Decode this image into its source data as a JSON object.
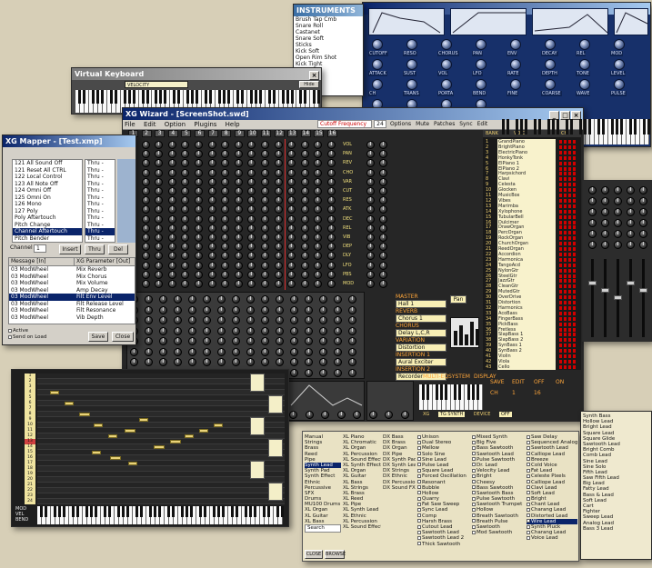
{
  "synth_editor": {
    "labels": [
      "CUTOFF",
      "RESO",
      "CHORUS",
      "PAN",
      "ENV",
      "DECAY",
      "REL",
      "MOD",
      "ATTACK",
      "SUST",
      "VOL",
      "LFO",
      "RATE",
      "DEPTH",
      "TONE",
      "LEVEL",
      "CH",
      "TRANS",
      "PORTA",
      "BEND",
      "FINE",
      "COARSE",
      "WAVE",
      "PULSE",
      "MIX",
      "GAIN",
      "VELO",
      "KEY",
      "DELAY",
      "FEED",
      "SPREAD",
      "OUT"
    ]
  },
  "instrument_list": {
    "title": "INSTRUMENTS",
    "items": [
      "Brush Tap Cmb",
      "Snare Roll",
      "Castanet",
      "Snare Soft",
      "Sticks",
      "Kick Soft",
      "Open Rim Shot",
      "Kick Tight",
      "Kick"
    ]
  },
  "virtual_keyboard": {
    "title": "Virtual Keyboard",
    "velocity_field": "VELOCITY",
    "close_btn": "Hide"
  },
  "main_window": {
    "title": "XG Wizard - [ScreenShot.swd]",
    "menu": [
      "File",
      "Edit",
      "Option",
      "Plugins",
      "Help"
    ],
    "toolbar_field": "Cutoff Frequency",
    "toolbar_field_value": "24",
    "toolbar_links": [
      "Options",
      "Mute",
      "Patches",
      "Sync",
      "Edit"
    ],
    "row_tags": [
      "VOL",
      "PAN",
      "REV",
      "CHO",
      "VAR",
      "CUT",
      "RES",
      "ATK",
      "DEC",
      "REL",
      "VIB",
      "DEP",
      "DLY",
      "LFO",
      "PBS",
      "MOD"
    ],
    "mode_labels": [
      "MASTER",
      "REVERB",
      "CHORUS",
      "VARIATION",
      "INSERTION 1",
      "INSERTION 2"
    ],
    "mode_values": [
      "Hall 1",
      "Chorus 1",
      "Delay L,C,R",
      "Distortion",
      "Aural Exciter",
      "Recorder"
    ],
    "side_labels": [
      "MULTI-EQ",
      "SYSTEM",
      "DISPLAY"
    ],
    "mode_note": "Pan",
    "voice_header": [
      "BANK",
      "VOICE",
      "CH"
    ],
    "voices": [
      "GrandPiano",
      "BrightPiano",
      "ElectricPiano",
      "HonkyTonk",
      "ElPiano 1",
      "ElPiano 2",
      "Harpsichord",
      "Clavi",
      "Celesta",
      "Glocken",
      "MusicBox",
      "Vibes",
      "Marimba",
      "Xylophone",
      "TubularBell",
      "Dulcimer",
      "DrawOrgan",
      "PercOrgan",
      "RockOrgan",
      "ChurchOrgan",
      "ReedOrgan",
      "Accordion",
      "Harmonica",
      "TangoAcd",
      "NylonGtr",
      "SteelGtr",
      "JazzGtr",
      "CleanGtr",
      "MutedGtr",
      "OverDrive",
      "Distortion",
      "Harmonics",
      "AcoBass",
      "FingerBass",
      "PickBass",
      "Fretless",
      "SlapBass 1",
      "SlapBass 2",
      "SynBass 1",
      "SynBass 2",
      "Violin",
      "Viola",
      "Cello"
    ],
    "bottom_labels": [
      "SAVE",
      "EDIT",
      "OFF",
      "ON",
      "CH",
      "1",
      "16"
    ],
    "status": [
      "XG",
      "TG SYNTH",
      "DEVICE",
      "OFF"
    ]
  },
  "mapper": {
    "title": "XG Mapper - [Test.xmp]",
    "message_list": [
      "121 All Sound Off",
      "121 Reset All CTRL",
      "122 Local Control",
      "123 All Note Off",
      "124 Omni Off",
      "125 Omni On",
      "126 Mono",
      "127 Poly",
      "Poly Aftertouch",
      "Pitch Change",
      "Channel Aftertouch",
      "Pitch Bender"
    ],
    "side_list": [
      "Thru -",
      "Thru -",
      "Thru -",
      "Thru -",
      "Thru -",
      "Thru -",
      "Thru -",
      "Thru -",
      "Thru -",
      "Thru -",
      "Thru -",
      "Thru -"
    ],
    "selected_index": 10,
    "controls": [
      "Channel",
      "Insert",
      "Thru",
      "Del"
    ],
    "channel_value": "1",
    "grid_headers": [
      "Message [In]",
      "XG Parameter [Out]"
    ],
    "grid_rows": [
      [
        "03 ModWheel",
        "Mix Reverb"
      ],
      [
        "03 ModWheel",
        "Mix Chorus"
      ],
      [
        "03 ModWheel",
        "Mix Volume"
      ],
      [
        "03 ModWheel",
        "Amp Decay"
      ],
      [
        "03 ModWheel",
        "Filt Env Level"
      ],
      [
        "03 ModWheel",
        "Filt Release Level"
      ],
      [
        "03 ModWheel",
        "Filt Resonance"
      ],
      [
        "03 ModWheel",
        "Vib Depth"
      ]
    ],
    "grid_selected": 4,
    "checkboxes": [
      "Active",
      "Send on Load"
    ],
    "buttons": [
      "Save",
      "Close"
    ]
  },
  "piano_roll": {
    "track_labels": [
      "1",
      "2",
      "3",
      "4",
      "5",
      "6",
      "7",
      "8",
      "9",
      "10",
      "11",
      "12",
      "13",
      "14",
      "15",
      "16",
      "17",
      "18",
      "19",
      "20",
      "21",
      "22",
      "23",
      "24"
    ],
    "footer": [
      "MOD",
      "VEL",
      "BEND"
    ]
  },
  "browser": {
    "col1": [
      "Manual",
      "Strings",
      "Brass",
      "Reed",
      "Pipe",
      "Synth Lead",
      "Synth Pad",
      "Synth Effect",
      "Ethnic",
      "Percussive",
      "SFX",
      "Drums",
      "MU100 Drums",
      "XL Organ",
      "XL Guitar",
      "XL Bass"
    ],
    "col1_selected": 5,
    "col2": [
      "XL Piano",
      "XL Chromatic",
      "XL Organ",
      "XL Percussion",
      "XL Sound Effect",
      "XL Synth Effect",
      "XL Organ",
      "XL Guitar",
      "XL Bass",
      "XL Strings",
      "XL Brass",
      "XL Reed",
      "XL Pipe",
      "XL Synth Lead",
      "XL Ethnic",
      "XL Percussion",
      "XL Sound Effect"
    ],
    "col3": [
      "DX Bass",
      "DX Brass",
      "DX Organ",
      "DX Pipe",
      "DX Synth Pad",
      "DX Synth Lead",
      "DX Strings",
      "DX Ethnic",
      "DX Percussion",
      "DX Sound FX"
    ],
    "col4": [
      "Unison",
      "Dual Stereo",
      "Mellow",
      "Solo Sine",
      "Sine Lead",
      "Pulse Lead",
      "Square Lead",
      "Forced Oscillation",
      "Resonant",
      "Bubble",
      "Hollow",
      "Quarry",
      "Fat Saw Sweep",
      "Sync Lead",
      "Comp",
      "Harsh Brass",
      "Cutout Lead",
      "Sawtooth Lead",
      "Sawtooth Lead 2",
      "Thick Sawtooth"
    ],
    "col5": [
      "Mixed Synth",
      "Big Five",
      "Bass Sawtooth",
      "Sawtooth Lead",
      "Pulse Sawtooth",
      "Dr. Lead",
      "Velocity Lead",
      "Bright",
      "Cheesy",
      "Bass Sawtooth",
      "Sawtooth Bass",
      "Pulse Sawtooth",
      "Sawtooth Trumpet",
      "Hollow",
      "Breath Sawtooth",
      "Breath Pulse",
      "Sawtooth",
      "Mod Sawtooth"
    ],
    "col6": [
      "Saw Delay",
      "Sequenced Analog",
      "Sawtooth Lead",
      "Calliope Lead",
      "Breeze",
      "Cold Voice",
      "Fat Lead",
      "Celeste Pixels",
      "Calliope Lead",
      "Clavi Lead",
      "Soft Lead",
      "Bright",
      "Chant Lead",
      "Charang Lead",
      "Distorted Lead",
      "Wire Lead",
      "Synth Pluck",
      "Charang Lead",
      "Voice Lead"
    ],
    "col6_selected": 15,
    "search_label": "Search",
    "bottom_buttons": [
      "CLOSE",
      "BROWSE"
    ]
  },
  "synth_list": {
    "items": [
      "Synth Bass",
      "Hollow Lead",
      "Bright Lead",
      "Square Lead",
      "Square Glide",
      "Sawtooth Lead",
      "Bright Comb",
      "Comb Lead",
      "Sine Lead",
      "Sine Solo",
      "Fifth Lead",
      "Saw Fifth Lead",
      "Big Lead",
      "Fatty Lead",
      "Bass & Lead",
      "Soft Lead",
      "Cart",
      "Fighter",
      "Sweep Lead",
      "Analog Lead",
      "Bass 3 Lead"
    ]
  }
}
